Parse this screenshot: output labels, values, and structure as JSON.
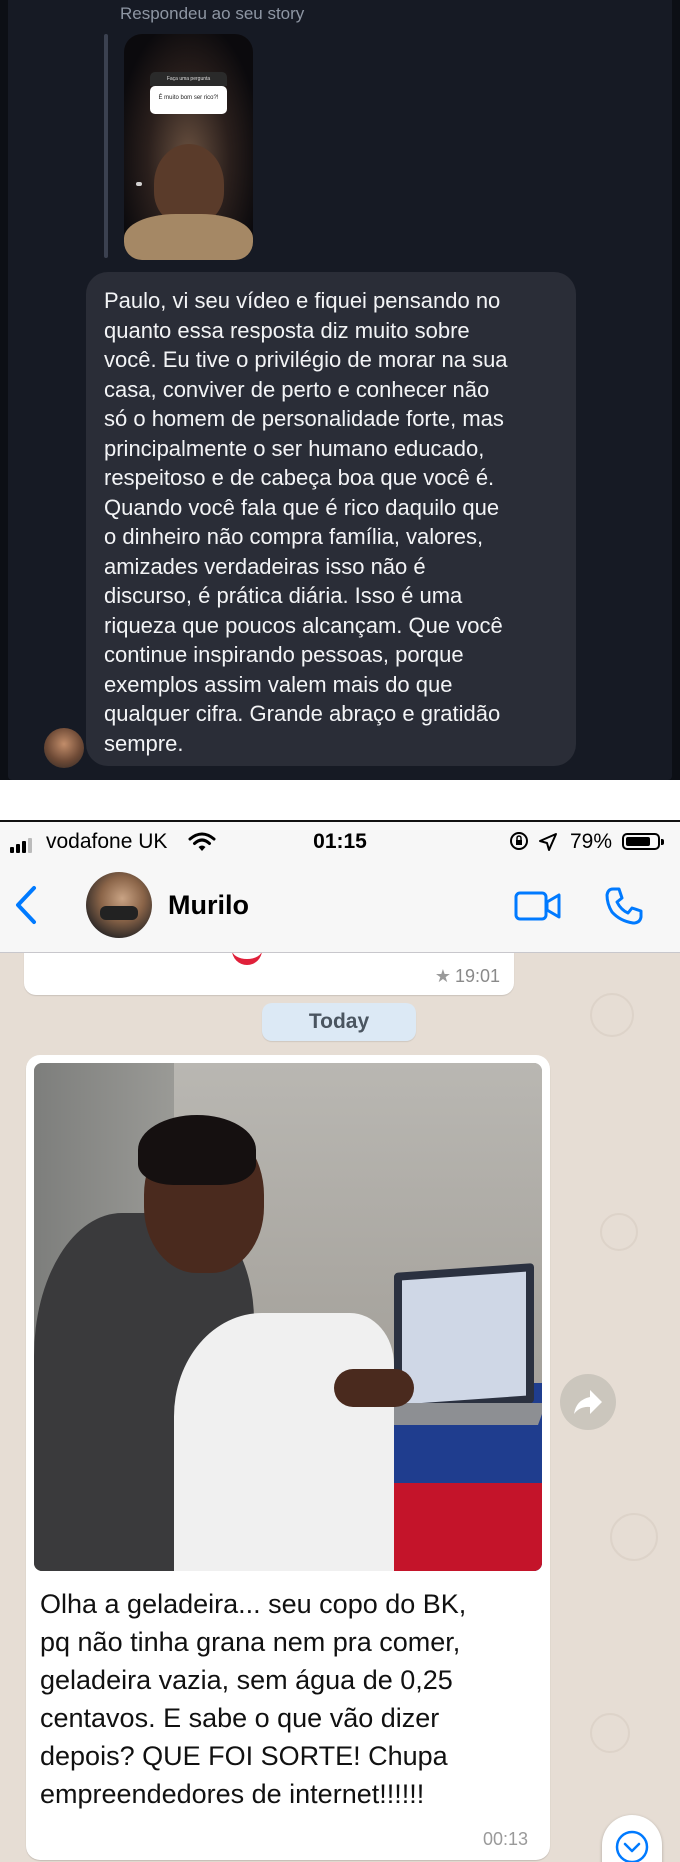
{
  "instagram": {
    "reply_label": "Respondeu ao seu story",
    "story_sticker": {
      "header": "Faça uma pergunta",
      "question": "É muito bom ser rico?!"
    },
    "message_lines": [
      "Paulo, vi seu vídeo e fiquei pensando no",
      "quanto essa resposta diz muito sobre",
      "você. Eu tive o privilégio de morar na sua",
      "casa, conviver de perto e conhecer não",
      "só o homem de personalidade forte, mas",
      "principalmente o ser humano educado,",
      "respeitoso e de cabeça boa que você é.",
      "Quando você fala que é rico daquilo que",
      "o dinheiro não compra família, valores,",
      "amizades verdadeiras isso não é",
      "discurso, é prática diária. Isso é uma",
      "riqueza que poucos alcançam. Que você",
      "continue inspirando pessoas, porque",
      "exemplos assim valem mais do que",
      "qualquer cifra. Grande abraço e gratidão",
      "sempre."
    ]
  },
  "whatsapp": {
    "status_bar": {
      "carrier": "vodafone UK",
      "time": "01:15",
      "battery": "79%",
      "battery_level": 0.79
    },
    "header": {
      "contact_name": "Murilo",
      "back_icon": "chevron-left-icon",
      "video_icon": "video-camera-icon",
      "call_icon": "phone-icon"
    },
    "previous_message": {
      "time": "19:01",
      "starred": true
    },
    "date_separator": "Today",
    "message": {
      "caption_lines": [
        "Olha a geladeira... seu copo do BK,",
        "pq não tinha grana nem pra comer,",
        "geladeira vazia, sem água de 0,25",
        "centavos. E sabe o que vão dizer",
        "depois? QUE FOI SORTE! Chupa",
        "empreendedores de internet!!!!!!"
      ],
      "time": "00:13"
    },
    "colors": {
      "accent": "#007aff",
      "chat_background": "#e6ddd4",
      "date_pill": "#dce9f5"
    }
  }
}
